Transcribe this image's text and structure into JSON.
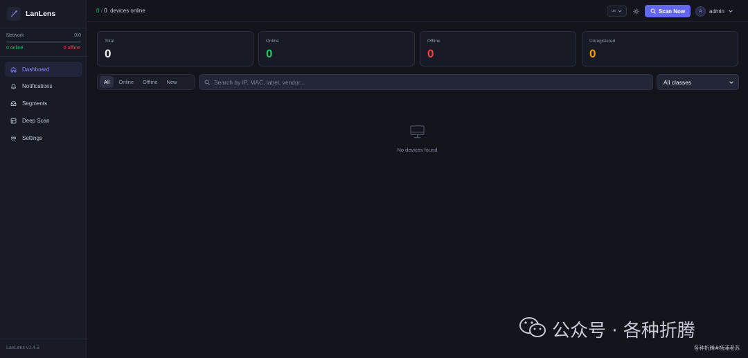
{
  "app": {
    "name": "LanLens",
    "version": "LanLens v1.4.3"
  },
  "network": {
    "label": "Network",
    "ratio": "0/0",
    "online": "0 online",
    "offline": "0 offline",
    "fill_fraction": 0
  },
  "nav": [
    {
      "label": "Dashboard",
      "icon": "home-icon",
      "active": true
    },
    {
      "label": "Notifications",
      "icon": "bell-icon"
    },
    {
      "label": "Segments",
      "icon": "layers-icon"
    },
    {
      "label": "Deep Scan",
      "icon": "table-icon"
    },
    {
      "label": "Settings",
      "icon": "gear-icon"
    }
  ],
  "topbar": {
    "online_count": "0",
    "separator": "/",
    "total_count": "0",
    "suffix": "devices online",
    "lang": "us",
    "scan_label": "Scan Now",
    "user_initial": "A",
    "user_name": "admin"
  },
  "stats": [
    {
      "label": "Total",
      "value": "0",
      "color": "#f1f2f8"
    },
    {
      "label": "Online",
      "value": "0",
      "color": "#22c55e"
    },
    {
      "label": "Offline",
      "value": "0",
      "color": "#ef4444"
    },
    {
      "label": "Unregistered",
      "value": "0",
      "color": "#f59e0b"
    }
  ],
  "filters": {
    "tabs": [
      "All",
      "Online",
      "Offline",
      "New"
    ],
    "active": "All"
  },
  "search": {
    "placeholder": "Search by IP, MAC, label, vendor...",
    "value": ""
  },
  "class_filter": {
    "selected": "All classes"
  },
  "empty": {
    "text": "No devices found"
  },
  "colors": {
    "accent": "#6366f1",
    "online": "#22c55e",
    "offline": "#ef4444",
    "warning": "#f59e0b"
  },
  "watermark": {
    "main": "公众号 · 各种折腾",
    "sub": "各种折腾#杨浦老苏"
  }
}
